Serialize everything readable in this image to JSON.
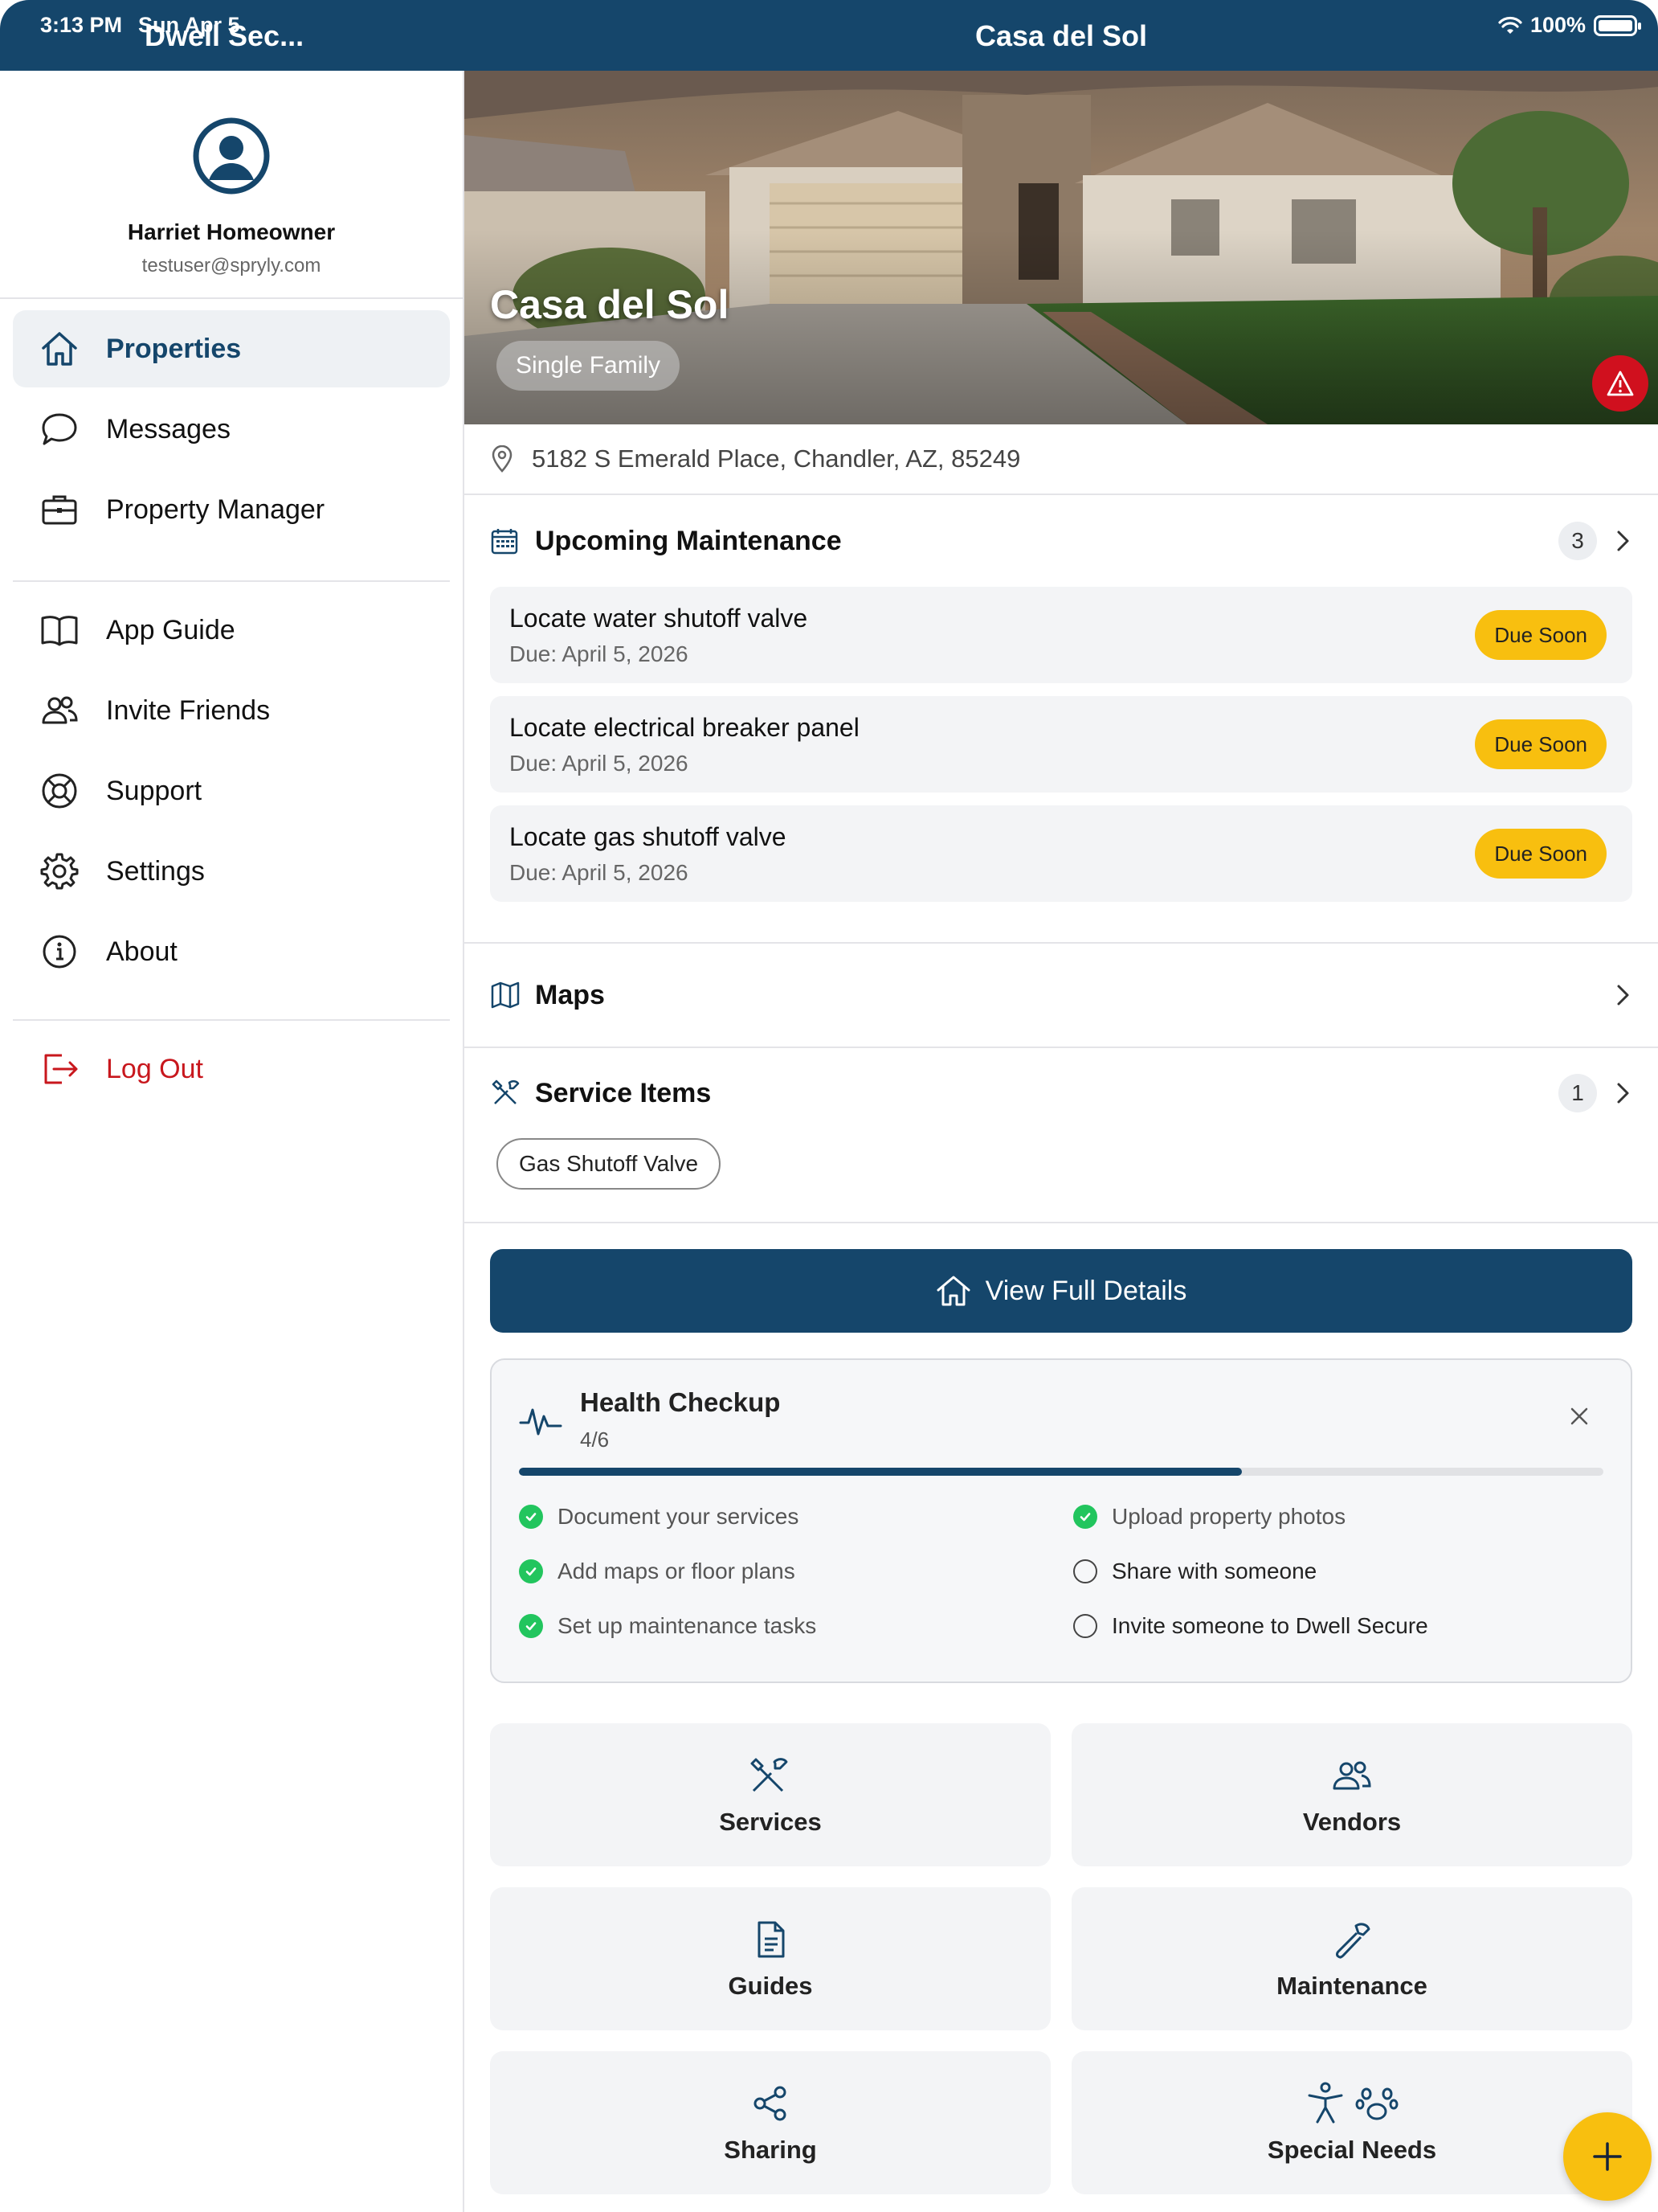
{
  "status": {
    "time": "3:13 PM",
    "date": "Sun Apr 5",
    "battery": "100%"
  },
  "sidebar": {
    "title": "Dwell Sec...",
    "profile": {
      "name": "Harriet Homeowner",
      "email": "testuser@spryly.com"
    },
    "items": [
      {
        "label": "Properties",
        "icon": "home-icon",
        "active": true
      },
      {
        "label": "Messages",
        "icon": "chat-icon"
      },
      {
        "label": "Property Manager",
        "icon": "briefcase-icon"
      }
    ],
    "items2": [
      {
        "label": "App Guide",
        "icon": "book-icon"
      },
      {
        "label": "Invite Friends",
        "icon": "users-icon"
      },
      {
        "label": "Support",
        "icon": "lifebuoy-icon"
      },
      {
        "label": "Settings",
        "icon": "gear-icon"
      },
      {
        "label": "About",
        "icon": "info-icon"
      }
    ],
    "logout": "Log Out"
  },
  "header": {
    "title": "Casa del Sol"
  },
  "property": {
    "name": "Casa del Sol",
    "type": "Single Family",
    "address": "5182 S Emerald Place, Chandler, AZ, 85249"
  },
  "upcoming": {
    "title": "Upcoming Maintenance",
    "count": "3",
    "items": [
      {
        "title": "Locate water shutoff valve",
        "due": "Due: April 5, 2026",
        "badge": "Due Soon"
      },
      {
        "title": "Locate electrical breaker panel",
        "due": "Due: April 5, 2026",
        "badge": "Due Soon"
      },
      {
        "title": "Locate gas shutoff valve",
        "due": "Due: April 5, 2026",
        "badge": "Due Soon"
      }
    ]
  },
  "maps": {
    "title": "Maps"
  },
  "service_items": {
    "title": "Service Items",
    "count": "1",
    "chips": [
      "Gas Shutoff Valve"
    ]
  },
  "view_details": "View Full Details",
  "health": {
    "title": "Health Checkup",
    "count": "4/6",
    "progress": 0.667,
    "items": [
      {
        "label": "Document your services",
        "done": true
      },
      {
        "label": "Upload property photos",
        "done": true
      },
      {
        "label": "Add maps or floor plans",
        "done": true
      },
      {
        "label": "Share with someone",
        "done": false
      },
      {
        "label": "Set up maintenance tasks",
        "done": true
      },
      {
        "label": "Invite someone to Dwell Secure",
        "done": false
      }
    ]
  },
  "tiles": [
    {
      "label": "Services",
      "icon": "tools-icon"
    },
    {
      "label": "Vendors",
      "icon": "users-icon"
    },
    {
      "label": "Guides",
      "icon": "document-icon"
    },
    {
      "label": "Maintenance",
      "icon": "wrench-icon"
    },
    {
      "label": "Sharing",
      "icon": "share-icon"
    },
    {
      "label": "Special Needs",
      "icon": "accessibility-paw-icon"
    }
  ],
  "colors": {
    "brand": "#15466b",
    "accent": "#f8bf0f",
    "danger": "#c8171d",
    "success": "#22c55e"
  }
}
